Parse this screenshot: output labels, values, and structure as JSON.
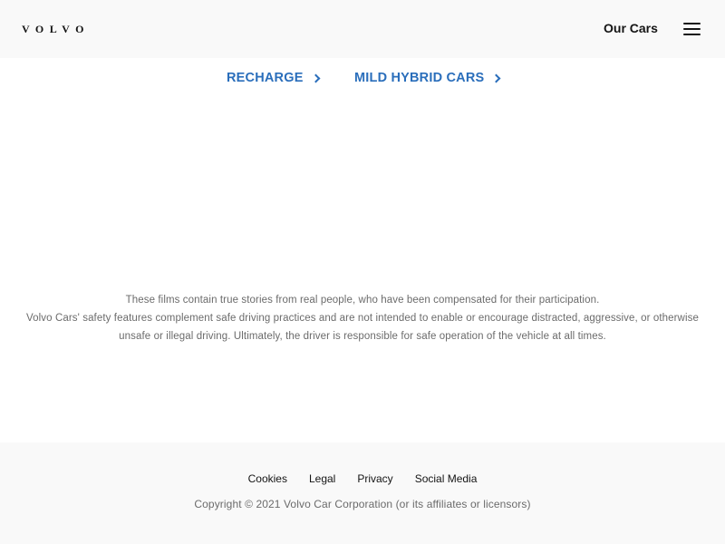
{
  "header": {
    "logo_text": "VOLVO",
    "nav_label": "Our Cars",
    "menu_icon": "hamburger-menu-icon"
  },
  "links": [
    {
      "label": "RECHARGE",
      "icon": "chevron-right-icon"
    },
    {
      "label": "MILD HYBRID CARS",
      "icon": "chevron-right-icon"
    }
  ],
  "disclaimer": {
    "line1": "These films contain true stories from real people, who have been compensated for their participation.",
    "line2": "Volvo Cars' safety features complement safe driving practices and are not intended to enable or encourage distracted, aggressive, or otherwise unsafe or illegal driving. Ultimately, the driver is responsible for safe operation of the vehicle at all times."
  },
  "footer": {
    "links": [
      "Cookies",
      "Legal",
      "Privacy",
      "Social Media"
    ],
    "copyright": "Copyright © 2021 Volvo Car Corporation (or its affiliates or licensors)"
  },
  "colors": {
    "link_blue": "#2a6ebb",
    "header_bg": "#f9f9f9",
    "text_dark": "#141414",
    "text_muted": "#6b6b6b"
  }
}
